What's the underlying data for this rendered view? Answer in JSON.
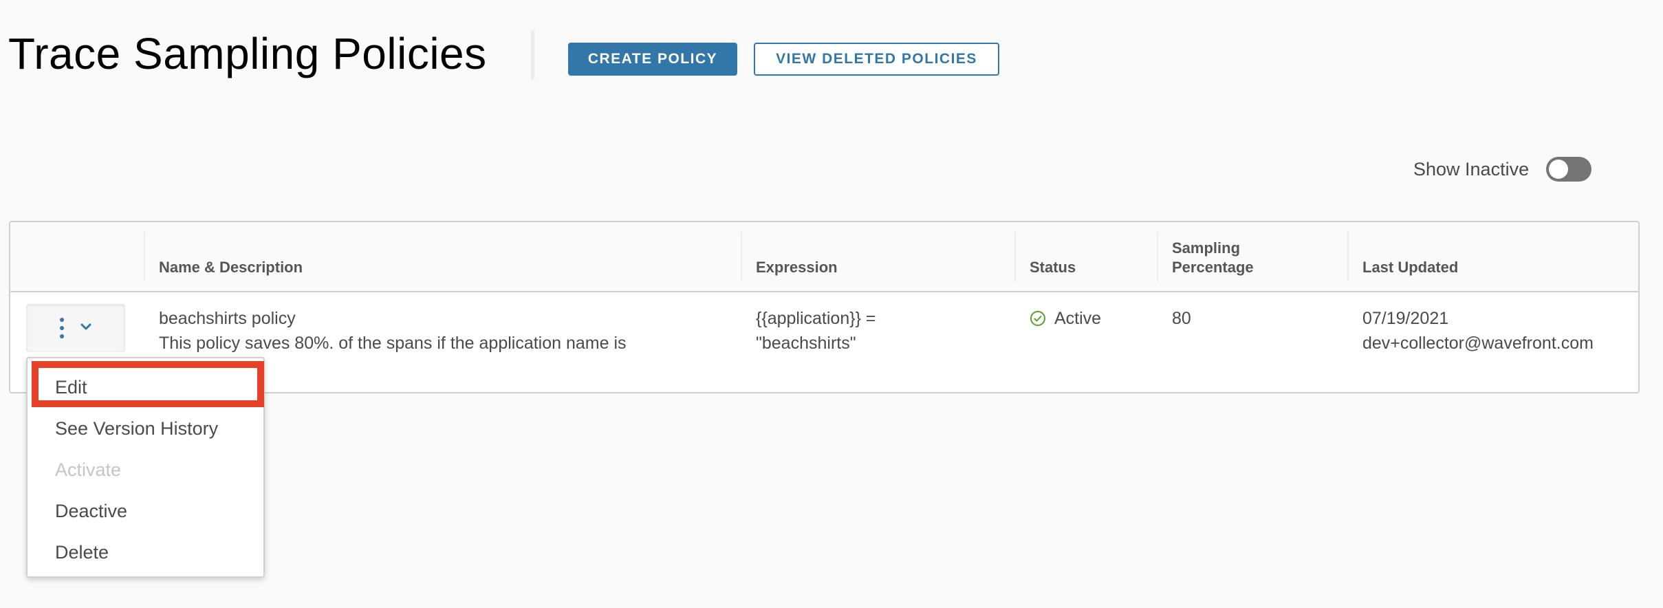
{
  "header": {
    "title": "Trace Sampling Policies",
    "create_button": "CREATE POLICY",
    "view_deleted_button": "VIEW DELETED POLICIES"
  },
  "filters": {
    "show_inactive_label": "Show Inactive",
    "show_inactive_on": false
  },
  "table": {
    "columns": [
      "",
      "Name & Description",
      "Expression",
      "Status",
      "Sampling Percentage",
      "Last Updated"
    ],
    "rows": [
      {
        "name": "beachshirts policy",
        "description": "This policy saves 80%. of the spans if the application name is",
        "expression_line1": "{{application}} =",
        "expression_line2": "\"beachshirts\"",
        "status": "Active",
        "status_icon": "circle-check-icon",
        "sampling_percentage": "80",
        "last_updated_date": "07/19/2021",
        "last_updated_by": "dev+collector@wavefront.com"
      }
    ]
  },
  "row_menu": {
    "items": [
      {
        "label": "Edit",
        "disabled": false,
        "highlighted": true
      },
      {
        "label": "See Version History",
        "disabled": false
      },
      {
        "label": "Activate",
        "disabled": true
      },
      {
        "label": "Deactive",
        "disabled": false
      },
      {
        "label": "Delete",
        "disabled": false
      }
    ]
  },
  "colors": {
    "brand": "#3277a8",
    "status_active": "#5a9e2e",
    "highlight": "#e8412a"
  }
}
